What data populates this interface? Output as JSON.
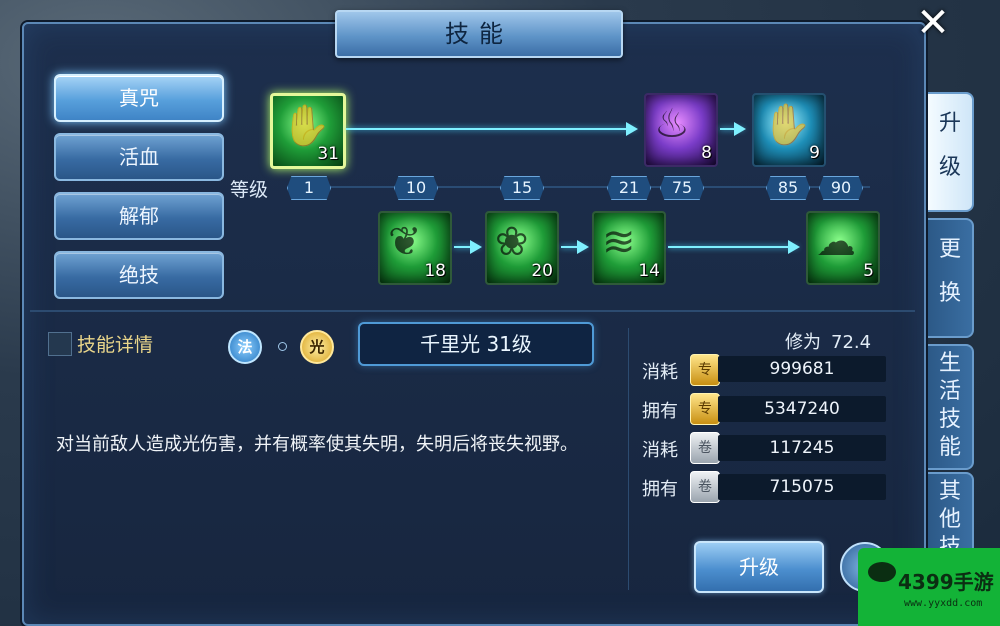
{
  "window": {
    "title": "技能",
    "close_symbol": "✕"
  },
  "categories": [
    {
      "label": "真咒",
      "active": true
    },
    {
      "label": "活血",
      "active": false
    },
    {
      "label": "解郁",
      "active": false
    },
    {
      "label": "绝技",
      "active": false
    }
  ],
  "right_tabs": [
    {
      "lines": [
        "升",
        "级"
      ],
      "active": true
    },
    {
      "lines": [
        "更",
        "换"
      ],
      "active": false
    },
    {
      "lines": [
        "生",
        "活",
        "技",
        "能"
      ],
      "active": false
    },
    {
      "lines": [
        "其",
        "他",
        "技"
      ],
      "active": false
    }
  ],
  "level_label": "等级",
  "levels": [
    "1",
    "10",
    "15",
    "21",
    "75",
    "85",
    "90"
  ],
  "skill_tree": {
    "row1": [
      {
        "num": "31",
        "icon": "grasp-hand-icon",
        "color": "green",
        "selected": true
      },
      {
        "num": "8",
        "icon": "purple-flame-hand-icon",
        "color": "purple"
      },
      {
        "num": "9",
        "icon": "cyan-orb-hand-icon",
        "color": "cyan"
      }
    ],
    "row2": [
      {
        "num": "18",
        "icon": "vine-icon",
        "color": "green"
      },
      {
        "num": "20",
        "icon": "orb-cluster-icon",
        "color": "green"
      },
      {
        "num": "14",
        "icon": "wave-icon",
        "color": "green"
      },
      {
        "num": "5",
        "icon": "wind-swirl-icon",
        "color": "green"
      }
    ]
  },
  "detail_checkbox_label": "技能详情",
  "badges": {
    "fa": "法",
    "guang": "光"
  },
  "skill_name": "千里光 31级",
  "description": "对当前敌人造成光伤害，并有概率使其失明，失明后将丧失视野。",
  "cultivation": {
    "label": "修为",
    "value": "72.4"
  },
  "resources": [
    {
      "label": "消耗",
      "icon": "exp-book-icon",
      "icon_text": "专",
      "value": "999681"
    },
    {
      "label": "拥有",
      "icon": "exp-book-icon",
      "icon_text": "专",
      "value": "5347240"
    },
    {
      "label": "消耗",
      "icon": "scroll-icon",
      "icon_text": "卷",
      "value": "117245"
    },
    {
      "label": "拥有",
      "icon": "scroll-icon",
      "icon_text": "卷",
      "value": "715075"
    }
  ],
  "upgrade_button": "升级",
  "watermark": {
    "logo": "4399手游",
    "url": "www.yyxdd.com"
  }
}
